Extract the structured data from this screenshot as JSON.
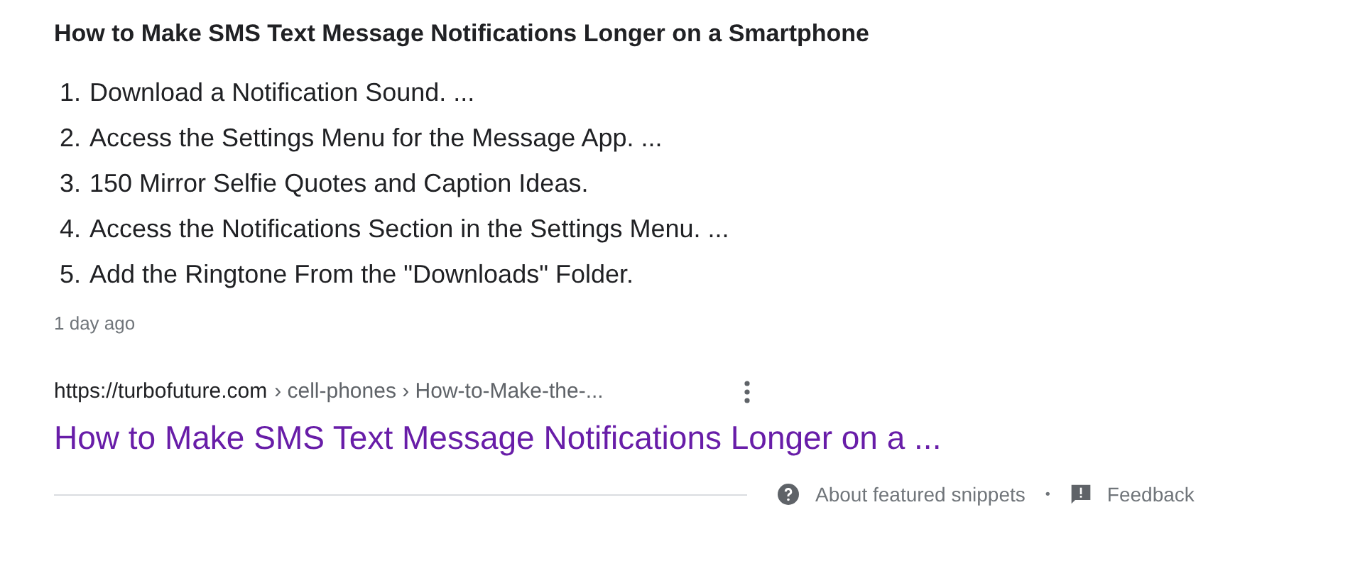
{
  "heading": "How to Make SMS Text Message Notifications Longer on a Smartphone",
  "steps": [
    {
      "number": "1.",
      "text": "Download a Notification Sound. ..."
    },
    {
      "number": "2.",
      "text": "Access the Settings Menu for the Message App. ..."
    },
    {
      "number": "3.",
      "text": "150 Mirror Selfie Quotes and Caption Ideas."
    },
    {
      "number": "4.",
      "text": "Access the Notifications Section in the Settings Menu. ..."
    },
    {
      "number": "5.",
      "text": "Add the Ringtone From the \"Downloads\" Folder."
    }
  ],
  "date": "1 day ago",
  "result": {
    "domain": "https://turbofuture.com",
    "path": "› cell-phones › How-to-Make-the-...",
    "title": "How to Make SMS Text Message Notifications Longer on a ..."
  },
  "footer": {
    "about": "About featured snippets",
    "separator": "•",
    "feedback": "Feedback"
  }
}
